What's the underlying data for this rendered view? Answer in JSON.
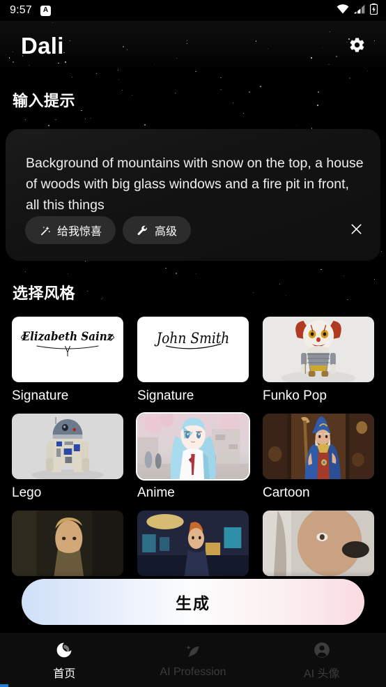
{
  "status_bar": {
    "time": "9:57",
    "app_badge_letter": "A",
    "wifi_icon": "wifi-icon",
    "signal_icon": "cellular-signal-icon",
    "battery_icon": "battery-charging-icon"
  },
  "app_bar": {
    "title": "Dali",
    "settings_icon": "gear-icon"
  },
  "prompt_section": {
    "title": "输入提示",
    "prompt_text": "Background of mountains with snow on the top, a house of woods with big glass windows and a fire pit in front, all this things",
    "surprise_label": "给我惊喜",
    "surprise_icon": "magic-wand-icon",
    "advanced_label": "高级",
    "advanced_icon": "wrench-icon",
    "close_icon": "close-icon"
  },
  "style_section": {
    "title": "选择风格",
    "selected_index": 4,
    "items": [
      {
        "label": "Signature",
        "art": "signature-elizabeth"
      },
      {
        "label": "Signature",
        "art": "signature-johnsmith"
      },
      {
        "label": "Funko Pop",
        "art": "funko-clown"
      },
      {
        "label": "Lego",
        "art": "lego-droid"
      },
      {
        "label": "Anime",
        "art": "anime-girl"
      },
      {
        "label": "Cartoon",
        "art": "cartoon-wizard"
      },
      {
        "label": "",
        "art": "dark-portrait"
      },
      {
        "label": "",
        "art": "comic-bar"
      },
      {
        "label": "",
        "art": "light-portrait"
      }
    ],
    "signature_1_text": "Elizabeth Sainz",
    "signature_2_text": "John Smith"
  },
  "generate_button": {
    "label": "生成",
    "gradient_start": "#cfe0f7",
    "gradient_mid": "#fdfdfd",
    "gradient_end": "#fadbe2"
  },
  "bottom_nav": {
    "items": [
      {
        "label": "首页",
        "icon": "spiral-home-icon",
        "active": true
      },
      {
        "label": "AI Profession",
        "icon": "sparkle-feather-icon",
        "active": false
      },
      {
        "label": "AI 头像",
        "icon": "person-circle-icon",
        "active": false
      }
    ]
  },
  "colors": {
    "background": "#000000",
    "card": "#141414",
    "chip": "#2c2c2c",
    "nav_bar": "#0d0d0d",
    "text_primary": "#ffffff",
    "text_inactive": "#3c3c3c"
  }
}
